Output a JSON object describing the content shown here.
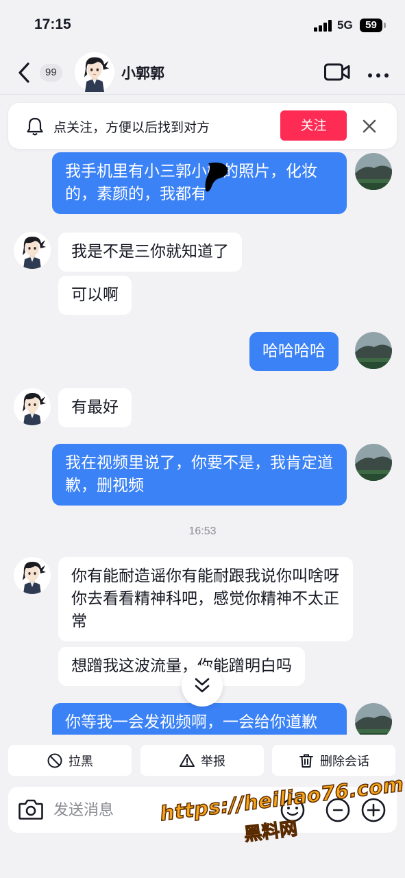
{
  "status_bar": {
    "time": "17:15",
    "network": "5G",
    "battery": "59"
  },
  "nav": {
    "unread_count": "99",
    "contact_name": "小郭郭"
  },
  "follow_banner": {
    "text": "点关注，方便以后找到对方",
    "button_label": "关注"
  },
  "messages": [
    {
      "side": "out",
      "text": "我手机里有小三郭小姐的照片，化妆的，素颜的，我都有"
    },
    {
      "side": "in",
      "text": "我是不是三你就知道了"
    },
    {
      "side": "in",
      "text": "可以啊"
    },
    {
      "side": "out",
      "text": "哈哈哈哈"
    },
    {
      "side": "in",
      "text": "有最好"
    },
    {
      "side": "out",
      "text": "我在视频里说了，你要不是，我肯定道歉，删视频"
    },
    {
      "side": "in",
      "text": "你有能耐造谣你有能耐跟我说你叫啥呀 你去看看精神科吧，感觉你精神不太正常"
    },
    {
      "side": "in",
      "text": "想蹭我这波流量，你能蹭明白吗"
    },
    {
      "side": "out",
      "text": "你等我一会发视频啊，一会给你道歉"
    }
  ],
  "time_divider": "16:53",
  "actions": {
    "block_label": "拉黑",
    "report_label": "举报",
    "delete_label": "删除会话"
  },
  "input": {
    "placeholder": "发送消息"
  },
  "watermark": {
    "url": "https://heiliao76.com",
    "name": "黑料网"
  },
  "colors": {
    "outgoing_bubble": "#3b82f6",
    "incoming_bubble": "#ffffff",
    "follow_button": "#fe2c55",
    "background": "#f2f2f5"
  }
}
